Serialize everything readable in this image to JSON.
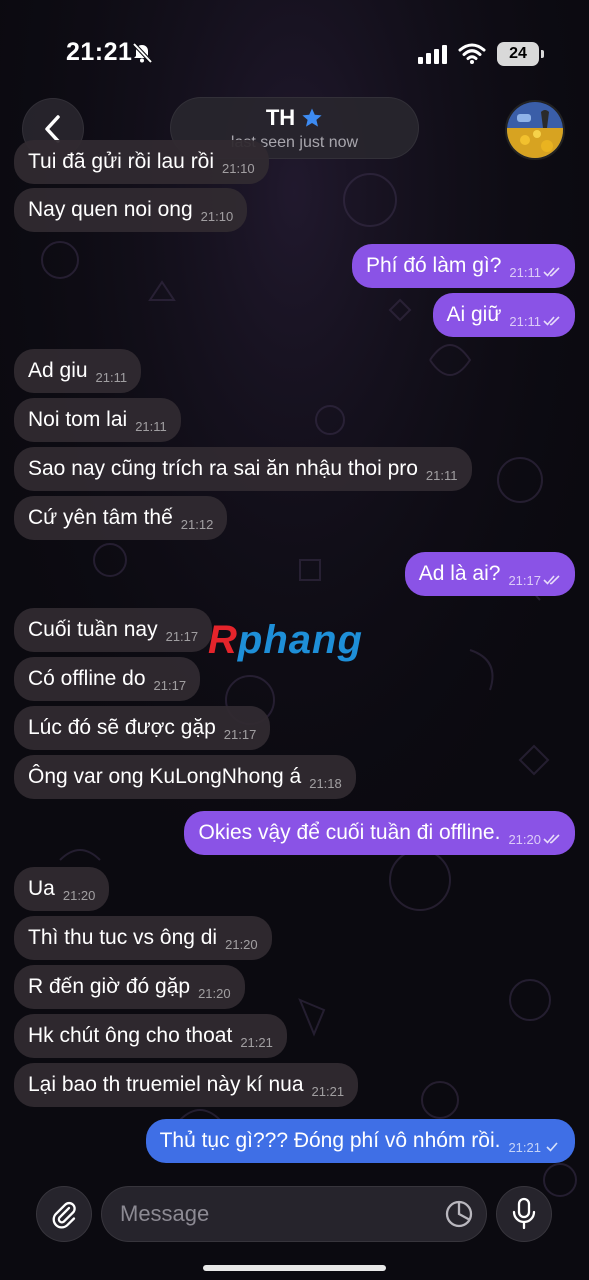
{
  "status_bar": {
    "time": "21:21",
    "battery": "24"
  },
  "header": {
    "name": "TH",
    "status": "last seen just now"
  },
  "messages": [
    {
      "dir": "in",
      "text": "Tui đã gửi rồi lau rồi",
      "time": "21:10"
    },
    {
      "dir": "in",
      "text": "Nay quen noi ong",
      "time": "21:10"
    },
    {
      "dir": "out",
      "text": "Phí đó làm gì?",
      "time": "21:11",
      "read": true
    },
    {
      "dir": "out",
      "text": "Ai giữ",
      "time": "21:11",
      "read": true
    },
    {
      "dir": "in",
      "text": "Ad giu",
      "time": "21:11"
    },
    {
      "dir": "in",
      "text": "Noi tom lai",
      "time": "21:11"
    },
    {
      "dir": "in",
      "text": "Sao nay cũng trích ra sai ăn nhậu thoi pro",
      "time": "21:11"
    },
    {
      "dir": "in",
      "text": "Cứ yên tâm thế",
      "time": "21:12"
    },
    {
      "dir": "out",
      "text": "Ad là ai?",
      "time": "21:17",
      "read": true
    },
    {
      "dir": "in",
      "text": "Cuối tuần nay",
      "time": "21:17"
    },
    {
      "dir": "in",
      "text": "Có offline do",
      "time": "21:17"
    },
    {
      "dir": "in",
      "text": "Lúc đó sẽ được gặp",
      "time": "21:17"
    },
    {
      "dir": "in",
      "text": "Ông var ong KuLongNhong á",
      "time": "21:18"
    },
    {
      "dir": "out",
      "text": "Okies vậy để cuối tuần đi offline.",
      "time": "21:20",
      "read": true
    },
    {
      "dir": "in",
      "text": "Ua",
      "time": "21:20"
    },
    {
      "dir": "in",
      "text": "Thì thu tuc vs ông di",
      "time": "21:20"
    },
    {
      "dir": "in",
      "text": "R đến giờ đó gặp",
      "time": "21:20"
    },
    {
      "dir": "in",
      "text": "Hk chút ông cho thoat",
      "time": "21:21"
    },
    {
      "dir": "in",
      "text": "Lại bao th truemiel này kí nua",
      "time": "21:21"
    },
    {
      "dir": "out",
      "text": "Thủ tục gì??? Đóng phí vô nhóm rồi.",
      "time": "21:21",
      "read": false,
      "style": "blue"
    }
  ],
  "watermark": {
    "first": "R",
    "rest": "phang"
  },
  "input": {
    "placeholder": "Message"
  },
  "colors": {
    "outgoing": "#8a53e6",
    "outgoing_last": "#3f6fe6",
    "incoming": "#302a30",
    "accent_star": "#3d8bf2"
  }
}
